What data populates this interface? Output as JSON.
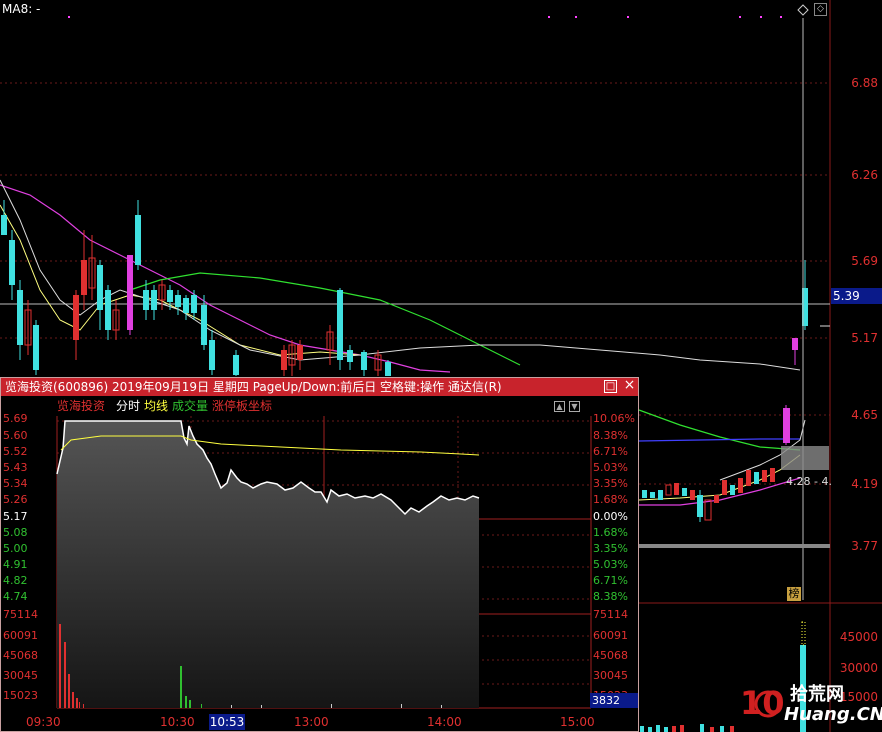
{
  "main_chart": {
    "ma_label": "MA8: -",
    "price_axis": [
      "6.88",
      "6.26",
      "5.69",
      "5.17",
      "4.65",
      "4.19",
      "3.77"
    ],
    "current_price_tag": "5.39",
    "overlay_label": "4.28 - 4.",
    "bang_label": "榜",
    "volume_axis": [
      "45000",
      "30000",
      "15000"
    ]
  },
  "popup": {
    "title": "览海投资(600896) 2019年09月19日 星期四 PageUp/Down:前后日 空格键:操作 通达信(R)",
    "restore_icon": "□",
    "close_icon": "×",
    "tabs": {
      "stock_name": "览海投资",
      "intraday": "分时",
      "avg_line": "均线",
      "volume": "成交量",
      "limit_axis": "涨停板坐标"
    },
    "left_axis": [
      "5.69",
      "5.60",
      "5.52",
      "5.43",
      "5.34",
      "5.26",
      "5.17",
      "5.08",
      "5.00",
      "4.91",
      "4.82",
      "4.74"
    ],
    "right_axis": [
      "10.06%",
      "8.38%",
      "6.71%",
      "5.03%",
      "3.35%",
      "1.68%",
      "0.00%",
      "1.68%",
      "3.35%",
      "5.03%",
      "6.71%",
      "8.38%"
    ],
    "vol_axis_left": [
      "75114",
      "60091",
      "45068",
      "30045",
      "15023"
    ],
    "vol_axis_right": [
      "75114",
      "60091",
      "45068",
      "30045",
      "15023"
    ],
    "vol_current": "3832",
    "time_axis": [
      "09:30",
      "10:30",
      "13:00",
      "14:00",
      "15:00"
    ],
    "cursor_time": "10:53",
    "colors": {
      "up": "#e03030",
      "down": "#30c030",
      "title_bg": "#c8232c"
    }
  },
  "watermark": {
    "text_top": "拾荒网",
    "text_bottom": "Huang.CN",
    "logo": "10"
  }
}
